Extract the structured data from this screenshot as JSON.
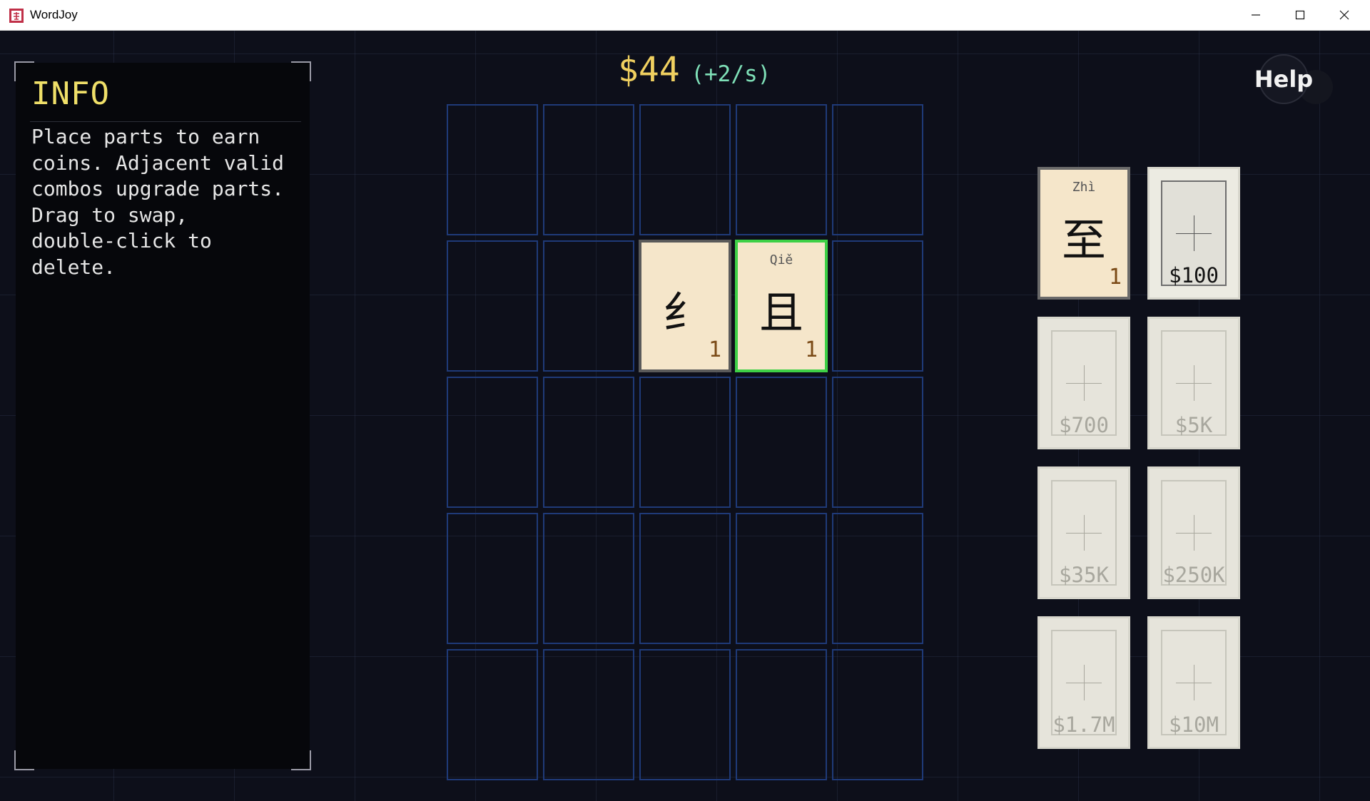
{
  "window": {
    "title": "WordJoy",
    "colors": {
      "titlebar_bg": "#ffffff",
      "icon_accent": "#c03048"
    }
  },
  "info": {
    "title": "INFO",
    "text": "Place parts to earn\ncoins. Adjacent valid\ncombos upgrade parts.\nDrag to swap,\ndouble-click to\ndelete."
  },
  "money": {
    "amount": "$44",
    "rate": "(+2/s)"
  },
  "help": {
    "label": "Help"
  },
  "board": {
    "rows": 5,
    "cols": 5,
    "tiles": [
      {
        "row": 1,
        "col": 2,
        "pinyin": "",
        "glyph": "纟",
        "level": "1",
        "selected": false
      },
      {
        "row": 1,
        "col": 3,
        "pinyin": "Qiě",
        "glyph": "且",
        "level": "1",
        "selected": true
      }
    ]
  },
  "shop": {
    "owned": {
      "pinyin": "Zhì",
      "glyph": "至",
      "level": "1"
    },
    "slots": [
      {
        "price": "$100",
        "active": true
      },
      {
        "price": "$700",
        "active": false
      },
      {
        "price": "$5K",
        "active": false
      },
      {
        "price": "$35K",
        "active": false
      },
      {
        "price": "$250K",
        "active": false
      },
      {
        "price": "$1.7M",
        "active": false
      },
      {
        "price": "$10M",
        "active": false
      }
    ]
  },
  "colors": {
    "background": "#0d0f1a",
    "cell_border": "#1f3a78",
    "tile_face": "#f5e6ca",
    "selected_border": "#3ed046",
    "money": "#f0d060",
    "rate": "#7fe0b8",
    "info_title": "#f0e069"
  }
}
